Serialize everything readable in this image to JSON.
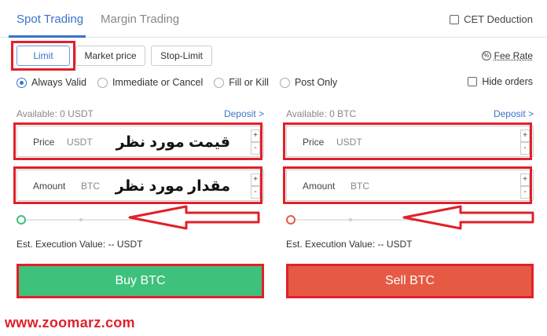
{
  "tabs": {
    "spot": "Spot Trading",
    "margin": "Margin Trading",
    "cet_deduction": "CET Deduction"
  },
  "order_types": {
    "limit": "Limit",
    "market": "Market price",
    "stop_limit": "Stop-Limit"
  },
  "fee_rate": {
    "label": "Fee Rate",
    "icon": "%"
  },
  "time_in_force": {
    "options": [
      "Always Valid",
      "Immediate or Cancel",
      "Fill or Kill",
      "Post Only"
    ],
    "selected": "Always Valid"
  },
  "hide_orders": "Hide orders",
  "buy": {
    "available": "Available: 0 USDT",
    "deposit": "Deposit >",
    "price_label": "Price",
    "price_unit": "USDT",
    "price_annotation": "قیمت مورد نظر",
    "amount_label": "Amount",
    "amount_unit": "BTC",
    "amount_annotation": "مقدار مورد نظر",
    "est_value": "Est. Execution Value: -- USDT",
    "button": "Buy BTC",
    "slider_percent": 0
  },
  "sell": {
    "available": "Available: 0 BTC",
    "deposit": "Deposit >",
    "price_label": "Price",
    "price_unit": "USDT",
    "amount_label": "Amount",
    "amount_unit": "BTC",
    "est_value": "Est. Execution Value: -- USDT",
    "button": "Sell BTC",
    "slider_percent": 0
  },
  "stepper": {
    "plus": "+",
    "minus": "-"
  },
  "colors": {
    "accent": "#3a73c9",
    "buy": "#3ec17b",
    "sell": "#e65a44",
    "annotation": "#e2202a"
  },
  "watermark": "www.zoomarz.com"
}
